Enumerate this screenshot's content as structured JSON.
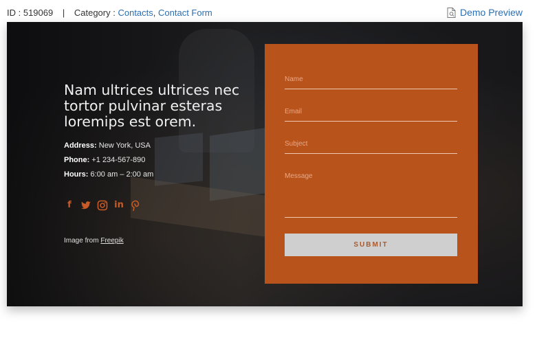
{
  "topbar": {
    "id_label": "ID : 519069",
    "separator": "|",
    "category_label": "Category :",
    "categories": [
      "Contacts",
      "Contact Form"
    ],
    "demo_label": "Demo Preview"
  },
  "hero": {
    "headline": "Nam ultrices ultrices nec tortor pulvinar esteras loremips est orem.",
    "info": [
      {
        "label": "Address:",
        "value": "New York, USA"
      },
      {
        "label": "Phone:",
        "value": "+1 234-567-890"
      },
      {
        "label": "Hours:",
        "value": "6:00 am – 2:00 am"
      }
    ],
    "socials": [
      "facebook-icon",
      "twitter-icon",
      "instagram-icon",
      "linkedin-icon",
      "pinterest-icon"
    ],
    "credit_prefix": "Image from",
    "credit_link": "Freepik"
  },
  "form": {
    "name_placeholder": "Name",
    "email_placeholder": "Email",
    "subject_placeholder": "Subject",
    "message_placeholder": "Message",
    "submit_label": "SUBMIT"
  },
  "colors": {
    "accent": "#b8531c",
    "link": "#2a6eb3",
    "button": "#cfcfcf"
  }
}
